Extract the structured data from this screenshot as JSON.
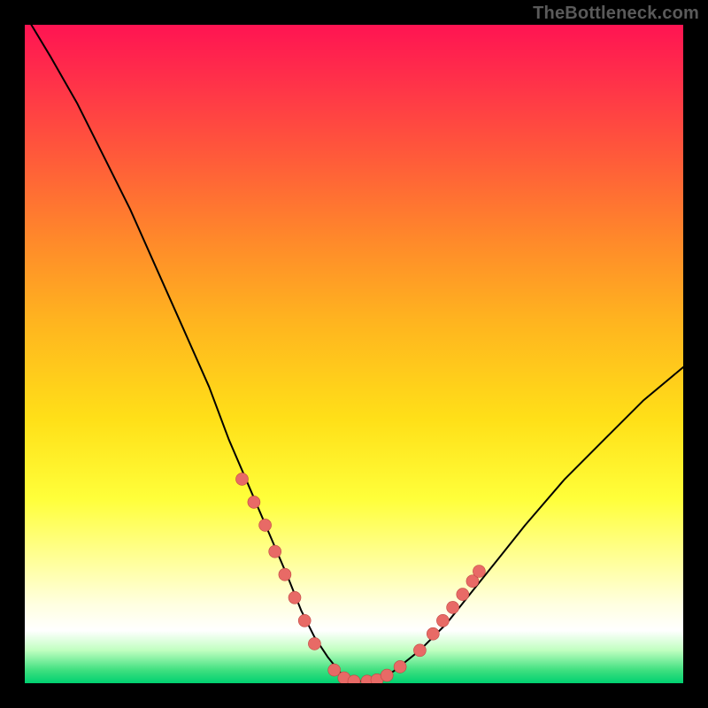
{
  "watermark_text": "TheBottleneck.com",
  "colors": {
    "page_bg": "#000000",
    "curve_stroke": "#000000",
    "point_fill": "#e86a66",
    "point_stroke": "#c04842",
    "watermark": "#5a5a5a"
  },
  "chart_data": {
    "type": "line",
    "title": "",
    "xlabel": "",
    "ylabel": "",
    "xlim": [
      0,
      100
    ],
    "ylim": [
      0,
      100
    ],
    "grid": false,
    "legend": false,
    "series": [
      {
        "name": "bottleneck-curve",
        "x": [
          1,
          4,
          8,
          12,
          16,
          20,
          24,
          28,
          31,
          34,
          37,
          40,
          42,
          44,
          46,
          48,
          50,
          53,
          56,
          60,
          64,
          68,
          72,
          76,
          82,
          88,
          94,
          100
        ],
        "y": [
          100,
          95,
          88,
          80,
          72,
          63,
          54,
          45,
          37,
          30,
          23,
          16,
          11,
          7,
          4,
          1.5,
          0.3,
          0.3,
          1.8,
          5,
          9,
          14,
          19,
          24,
          31,
          37,
          43,
          48
        ]
      }
    ],
    "points": {
      "name": "highlighted-points",
      "xy": [
        [
          33.0,
          31.0
        ],
        [
          34.8,
          27.5
        ],
        [
          36.5,
          24.0
        ],
        [
          38.0,
          20.0
        ],
        [
          39.5,
          16.5
        ],
        [
          41.0,
          13.0
        ],
        [
          42.5,
          9.5
        ],
        [
          44.0,
          6.0
        ],
        [
          47.0,
          2.0
        ],
        [
          48.5,
          0.8
        ],
        [
          50.0,
          0.3
        ],
        [
          52.0,
          0.3
        ],
        [
          53.5,
          0.5
        ],
        [
          55.0,
          1.2
        ],
        [
          57.0,
          2.5
        ],
        [
          60.0,
          5.0
        ],
        [
          62.0,
          7.5
        ],
        [
          63.5,
          9.5
        ],
        [
          65.0,
          11.5
        ],
        [
          66.5,
          13.5
        ],
        [
          68.0,
          15.5
        ],
        [
          69.0,
          17.0
        ]
      ]
    }
  }
}
